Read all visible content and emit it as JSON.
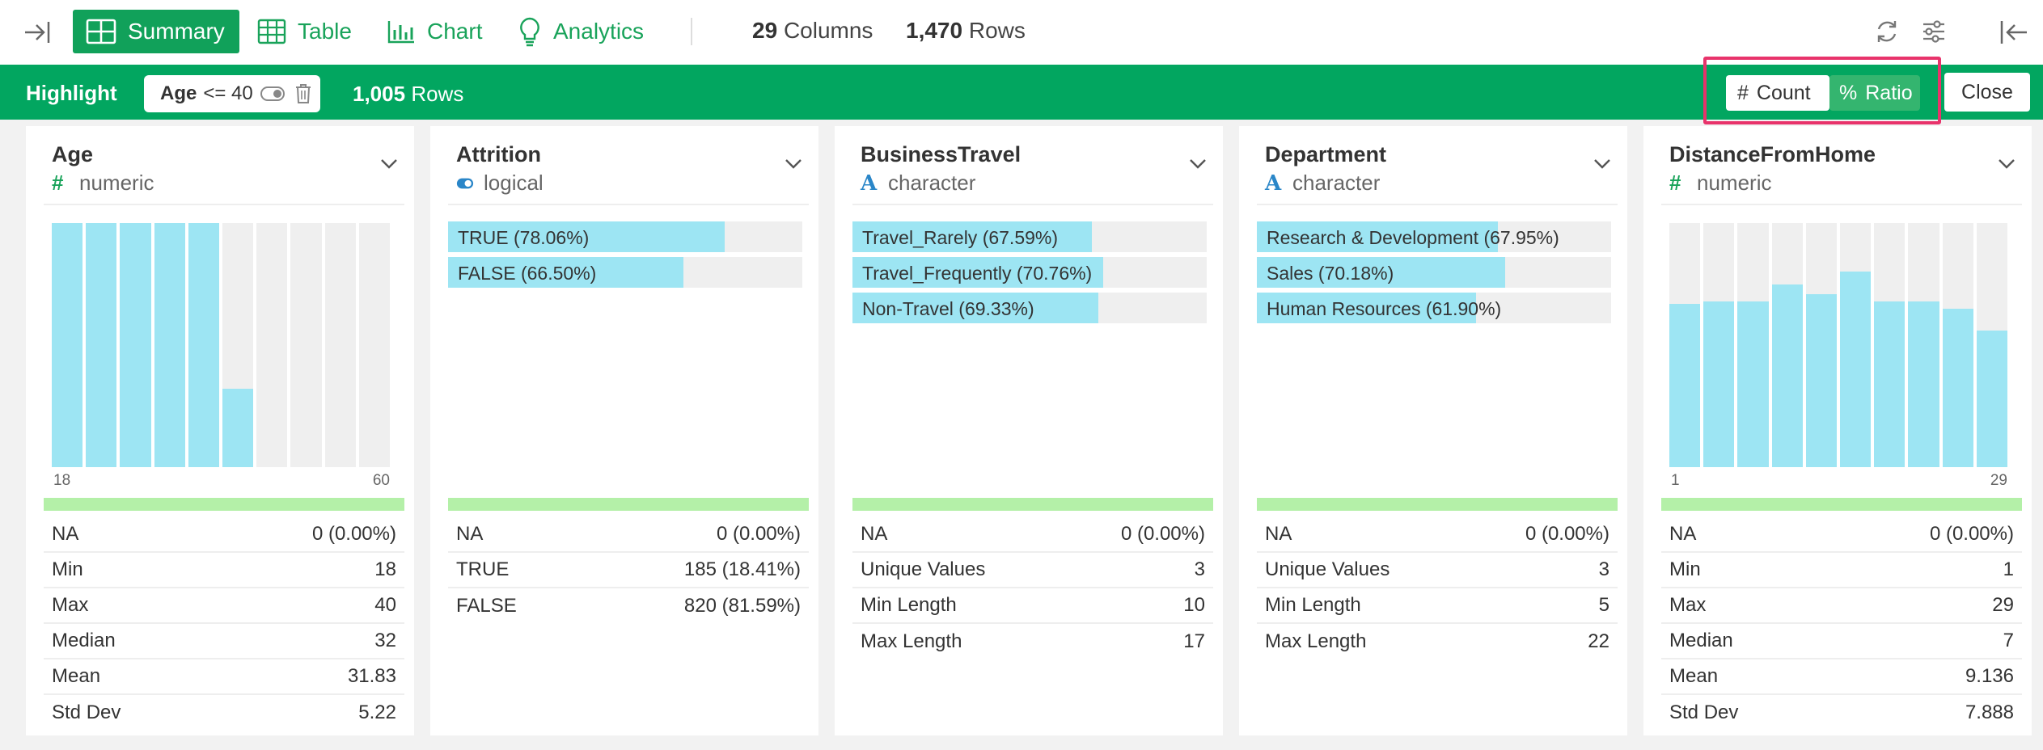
{
  "toolbar": {
    "tabs": [
      {
        "label": "Summary",
        "active": true
      },
      {
        "label": "Table",
        "active": false
      },
      {
        "label": "Chart",
        "active": false
      },
      {
        "label": "Analytics",
        "active": false
      }
    ],
    "columns_count": "29",
    "columns_label": "Columns",
    "rows_count": "1,470",
    "rows_label": "Rows"
  },
  "highlight": {
    "title": "Highlight",
    "filter_column": "Age",
    "filter_condition": "<= 40",
    "rows_count": "1,005",
    "rows_label": "Rows",
    "count_label": "Count",
    "ratio_label": "Ratio",
    "ratio_selected": true,
    "close_label": "Close"
  },
  "colors": {
    "brand": "#02a660",
    "bar": "#9de5f3",
    "track": "#efefef",
    "na_bar": "#b4f0a8",
    "annotation": "#e8336b"
  },
  "cards": [
    {
      "title": "Age",
      "type": "numeric",
      "type_icon": "hash-icon",
      "histogram": [
        1,
        1,
        1,
        1,
        1,
        0.32,
        0,
        0,
        0,
        0
      ],
      "axis_min": "18",
      "axis_max": "60",
      "stats": [
        {
          "label": "NA",
          "value": "0 (0.00%)"
        },
        {
          "label": "Min",
          "value": "18"
        },
        {
          "label": "Max",
          "value": "40"
        },
        {
          "label": "Median",
          "value": "32"
        },
        {
          "label": "Mean",
          "value": "31.83"
        },
        {
          "label": "Std Dev",
          "value": "5.22"
        }
      ]
    },
    {
      "title": "Attrition",
      "type": "logical",
      "type_icon": "toggle-icon",
      "categories": [
        {
          "label": "TRUE (78.06%)",
          "fraction": 0.7806
        },
        {
          "label": "FALSE (66.50%)",
          "fraction": 0.665
        }
      ],
      "stats": [
        {
          "label": "NA",
          "value": "0 (0.00%)"
        },
        {
          "label": "TRUE",
          "value": "185 (18.41%)"
        },
        {
          "label": "FALSE",
          "value": "820 (81.59%)"
        }
      ]
    },
    {
      "title": "BusinessTravel",
      "type": "character",
      "type_icon": "letter-a-icon",
      "categories": [
        {
          "label": "Travel_Rarely (67.59%)",
          "fraction": 0.6759
        },
        {
          "label": "Travel_Frequently (70.76%)",
          "fraction": 0.7076
        },
        {
          "label": "Non-Travel (69.33%)",
          "fraction": 0.6933
        }
      ],
      "stats": [
        {
          "label": "NA",
          "value": "0 (0.00%)"
        },
        {
          "label": "Unique Values",
          "value": "3"
        },
        {
          "label": "Min Length",
          "value": "10"
        },
        {
          "label": "Max Length",
          "value": "17"
        }
      ]
    },
    {
      "title": "Department",
      "type": "character",
      "type_icon": "letter-a-icon",
      "categories": [
        {
          "label": "Research & Development (67.95%)",
          "fraction": 0.6795
        },
        {
          "label": "Sales (70.18%)",
          "fraction": 0.7018
        },
        {
          "label": "Human Resources (61.90%)",
          "fraction": 0.619
        }
      ],
      "stats": [
        {
          "label": "NA",
          "value": "0 (0.00%)"
        },
        {
          "label": "Unique Values",
          "value": "3"
        },
        {
          "label": "Min Length",
          "value": "5"
        },
        {
          "label": "Max Length",
          "value": "22"
        }
      ]
    },
    {
      "title": "DistanceFromHome",
      "type": "numeric",
      "type_icon": "hash-icon",
      "histogram": [
        0.67,
        0.68,
        0.68,
        0.75,
        0.71,
        0.8,
        0.68,
        0.68,
        0.65,
        0.56
      ],
      "axis_min": "1",
      "axis_max": "29",
      "stats": [
        {
          "label": "NA",
          "value": "0 (0.00%)"
        },
        {
          "label": "Min",
          "value": "1"
        },
        {
          "label": "Max",
          "value": "29"
        },
        {
          "label": "Median",
          "value": "7"
        },
        {
          "label": "Mean",
          "value": "9.136"
        },
        {
          "label": "Std Dev",
          "value": "7.888"
        }
      ]
    }
  ]
}
